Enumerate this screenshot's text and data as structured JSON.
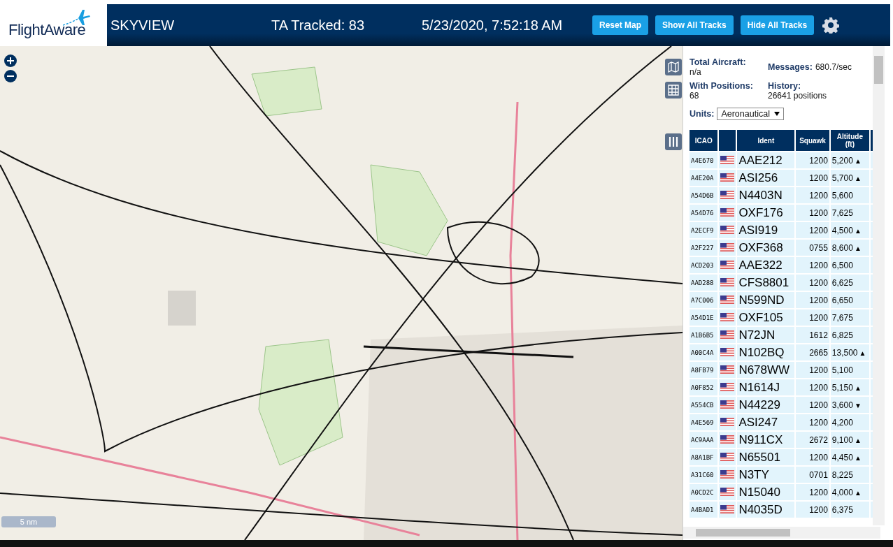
{
  "header": {
    "logo": "FlightAware",
    "title": "SKYVIEW",
    "tracked": "TA Tracked: 83",
    "datetime": "5/23/2020, 7:52:18 AM",
    "buttons": [
      "Reset Map",
      "Show All Tracks",
      "Hide All Tracks"
    ]
  },
  "map": {
    "scale": "5 nm"
  },
  "stats": [
    {
      "label": "Total Aircraft:",
      "value": "n/a"
    },
    {
      "label": "Messages:",
      "value": "680.7/sec"
    },
    {
      "label": "With Positions:",
      "value": "68"
    },
    {
      "label": "History:",
      "value": "26641 positions"
    }
  ],
  "units": {
    "label": "Units:",
    "value": "Aeronautical"
  },
  "table": {
    "columns": [
      "ICAO",
      "Ident",
      "Squawk",
      "Altitude (ft)"
    ],
    "rows": [
      {
        "icao": "A4E670",
        "ident": "AAE212",
        "squawk": "1200",
        "altitude": "5,200",
        "trend": "▲"
      },
      {
        "icao": "A4E20A",
        "ident": "ASI256",
        "squawk": "1200",
        "altitude": "5,700",
        "trend": "▲"
      },
      {
        "icao": "A54D6B",
        "ident": "N4403N",
        "squawk": "1200",
        "altitude": "5,600"
      },
      {
        "icao": "A54D76",
        "ident": "OXF176",
        "squawk": "1200",
        "altitude": "7,625"
      },
      {
        "icao": "A2ECF9",
        "ident": "ASI919",
        "squawk": "1200",
        "altitude": "4,500",
        "trend": "▲"
      },
      {
        "icao": "A2F227",
        "ident": "OXF368",
        "squawk": "0755",
        "altitude": "8,600",
        "trend": "▲"
      },
      {
        "icao": "ACD203",
        "ident": "AAE322",
        "squawk": "1200",
        "altitude": "6,500"
      },
      {
        "icao": "AAD288",
        "ident": "CFS8801",
        "squawk": "1200",
        "altitude": "6,625"
      },
      {
        "icao": "A7C006",
        "ident": "N599ND",
        "squawk": "1200",
        "altitude": "6,650"
      },
      {
        "icao": "A54D1E",
        "ident": "OXF105",
        "squawk": "1200",
        "altitude": "7,675"
      },
      {
        "icao": "A1B6B5",
        "ident": "N72JN",
        "squawk": "1612",
        "altitude": "6,825"
      },
      {
        "icao": "A00C4A",
        "ident": "N102BQ",
        "squawk": "2665",
        "altitude": "13,500",
        "trend": "▲"
      },
      {
        "icao": "A8FB79",
        "ident": "N678WW",
        "squawk": "1200",
        "altitude": "5,100"
      },
      {
        "icao": "A0F852",
        "ident": "N1614J",
        "squawk": "1200",
        "altitude": "5,150",
        "trend": "▲"
      },
      {
        "icao": "A554CB",
        "ident": "N44229",
        "squawk": "1200",
        "altitude": "3,600",
        "trend": "▼"
      },
      {
        "icao": "A4E569",
        "ident": "ASI247",
        "squawk": "1200",
        "altitude": "4,200"
      },
      {
        "icao": "AC9AAA",
        "ident": "N911CX",
        "squawk": "2672",
        "altitude": "9,100",
        "trend": "▲"
      },
      {
        "icao": "A8A1BF",
        "ident": "N65501",
        "squawk": "1200",
        "altitude": "4,450",
        "trend": "▲"
      },
      {
        "icao": "A31C60",
        "ident": "N3TY",
        "squawk": "0701",
        "altitude": "8,225"
      },
      {
        "icao": "A0CD2C",
        "ident": "N15040",
        "squawk": "1200",
        "altitude": "4,000",
        "trend": "▲"
      },
      {
        "icao": "A4BAD1",
        "ident": "N4035D",
        "squawk": "1200",
        "altitude": "6,375"
      }
    ]
  }
}
